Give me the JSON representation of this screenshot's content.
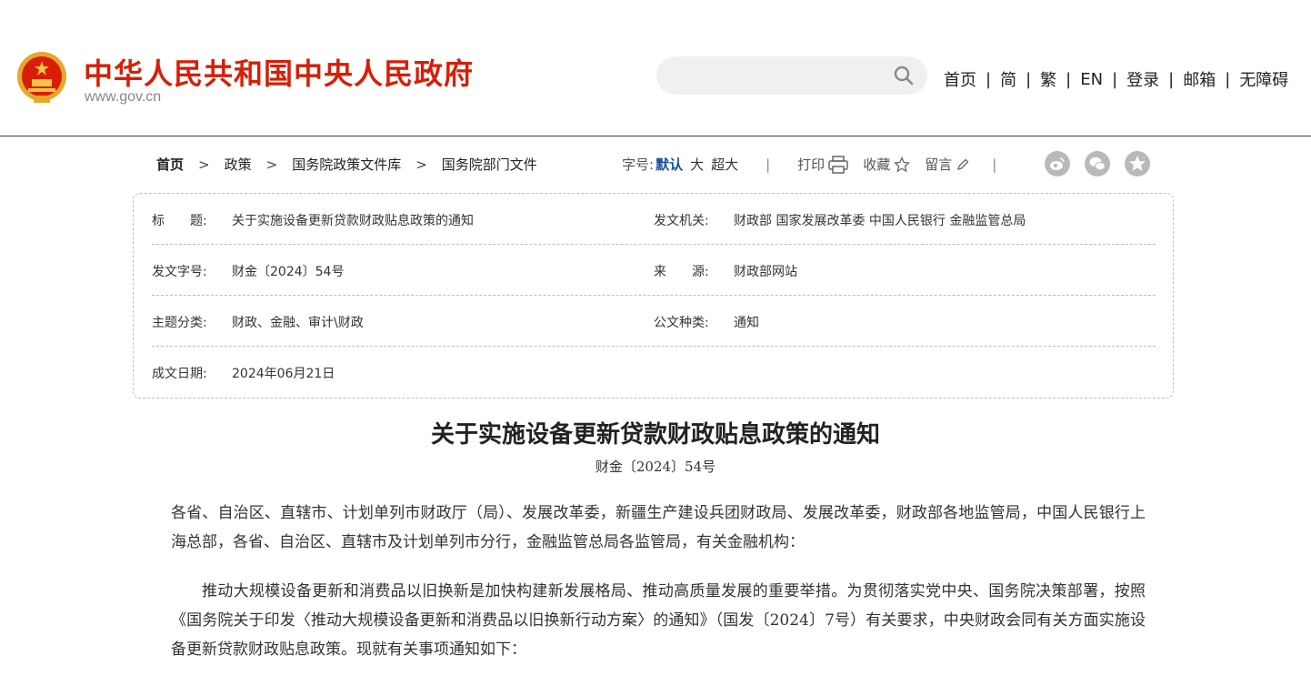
{
  "header": {
    "site_name": "中华人民共和国中央人民政府",
    "site_domain": "www.gov.cn",
    "search": {
      "placeholder": ""
    },
    "nav": [
      "首页",
      "简",
      "繁",
      "EN",
      "登录",
      "邮箱",
      "无障碍"
    ]
  },
  "breadcrumb": [
    "首页",
    "政策",
    "国务院政策文件库",
    "国务院部门文件"
  ],
  "tools": {
    "font_size_label": "字号:",
    "font_sizes": [
      "默认",
      "大",
      "超大"
    ],
    "print": "打印",
    "favorite": "收藏",
    "comment": "留言"
  },
  "social": [
    "weibo-icon",
    "wechat-icon",
    "qzone-icon"
  ],
  "colors": {
    "brand_red": "#d81e06",
    "link_blue": "#1a4f99",
    "header_rule": "#2b4560"
  },
  "info": {
    "title_label": "标　　题:",
    "title_value": "关于实施设备更新贷款财政贴息政策的通知",
    "issuer_label": "发文机关:",
    "issuer_value": "财政部 国家发展改革委 中国人民银行 金融监管总局",
    "docno_label": "发文字号:",
    "docno_value": "财金〔2024〕54号",
    "source_label": "来　　源:",
    "source_value": "财政部网站",
    "topic_label": "主题分类:",
    "topic_value": "财政、金融、审计\\财政",
    "type_label": "公文种类:",
    "type_value": "通知",
    "date_label": "成文日期:",
    "date_value": "2024年06月21日"
  },
  "article": {
    "title": "关于实施设备更新贷款财政贴息政策的通知",
    "doc_no": "财金〔2024〕54号",
    "paragraphs": [
      "各省、自治区、直辖市、计划单列市财政厅（局）、发展改革委，新疆生产建设兵团财政局、发展改革委，财政部各地监管局，中国人民银行上海总部，各省、自治区、直辖市及计划单列市分行，金融监管总局各监管局，有关金融机构：",
      "推动大规模设备更新和消费品以旧换新是加快构建新发展格局、推动高质量发展的重要举措。为贯彻落实党中央、国务院决策部署，按照《国务院关于印发〈推动大规模设备更新和消费品以旧换新行动方案〉的通知》（国发〔2024〕7号）有关要求，中央财政会同有关方面实施设备更新贷款财政贴息政策。现就有关事项通知如下："
    ]
  }
}
